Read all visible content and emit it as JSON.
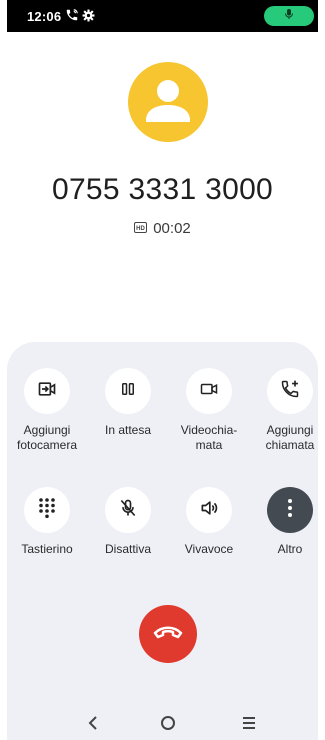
{
  "status_bar": {
    "time": "12:06",
    "icons": [
      "wifi-calling-icon",
      "gear-icon",
      "mic-icon"
    ],
    "mic_pill_color": "#27c97a"
  },
  "call": {
    "number": "0755 3331 3000",
    "quality_badge": "HD",
    "duration": "00:02",
    "avatar_color": "#f7c530"
  },
  "actions": [
    {
      "label_1": "Aggiungi",
      "label_2": "fotocamera",
      "icon": "add-camera-icon"
    },
    {
      "label_1": "In attesa",
      "label_2": "",
      "icon": "pause-icon"
    },
    {
      "label_1": "Videochia-",
      "label_2": "mata",
      "icon": "video-camera-icon"
    },
    {
      "label_1": "Aggiungi",
      "label_2": "chiamata",
      "icon": "add-call-icon"
    },
    {
      "label_1": "Tastierino",
      "label_2": "",
      "icon": "dialpad-icon"
    },
    {
      "label_1": "Disattiva",
      "label_2": "",
      "icon": "mic-off-icon"
    },
    {
      "label_1": "Vivavoce",
      "label_2": "",
      "icon": "speaker-icon"
    },
    {
      "label_1": "Altro",
      "label_2": "",
      "icon": "more-vertical-icon"
    }
  ],
  "end_call": {
    "icon": "end-call-icon",
    "color": "#e03a2f"
  },
  "nav_bar": [
    "back-icon",
    "home-icon",
    "recents-icon"
  ]
}
